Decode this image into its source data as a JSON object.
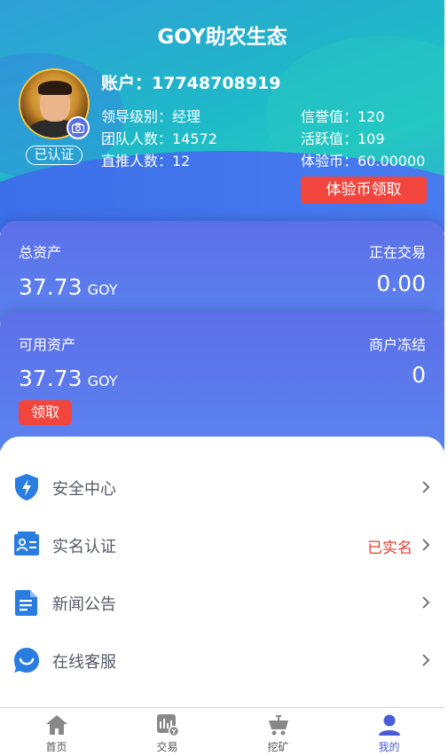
{
  "header": {
    "title": "GOY助农生态",
    "account": "账户：17748708919",
    "verified_badge": "已认证",
    "left_info": [
      "领导级别：经理",
      "团队人数：14572",
      "直推人数：12"
    ],
    "right_info": [
      "信誉值：120",
      "活跃值：109",
      "体验币：60.00000"
    ],
    "trial_button": "体验币领取"
  },
  "assets_card": {
    "total_label": "总资产",
    "total_value": "37.73",
    "total_unit": "GOY",
    "trading_label": "正在交易",
    "trading_value": "0.00"
  },
  "available_card": {
    "available_label": "可用资产",
    "available_value": "37.73",
    "available_unit": "GOY",
    "frozen_label": "商户冻结",
    "frozen_value": "0",
    "claim_button": "领取"
  },
  "menu": [
    {
      "label": "安全中心",
      "icon": "shield-bolt-icon",
      "tag": ""
    },
    {
      "label": "实名认证",
      "icon": "id-card-icon",
      "tag": "已实名"
    },
    {
      "label": "新闻公告",
      "icon": "document-icon",
      "tag": ""
    },
    {
      "label": "在线客服",
      "icon": "chat-bubble-icon",
      "tag": ""
    }
  ],
  "tabs": [
    {
      "label": "首页",
      "icon": "home-icon"
    },
    {
      "label": "交易",
      "icon": "trade-chart-icon"
    },
    {
      "label": "挖矿",
      "icon": "mining-cart-icon"
    },
    {
      "label": "我的",
      "icon": "user-icon",
      "active": true
    }
  ],
  "colors": {
    "accent": "#4a5bd8",
    "danger": "#f2453d",
    "icon_blue": "#2a7de0"
  }
}
